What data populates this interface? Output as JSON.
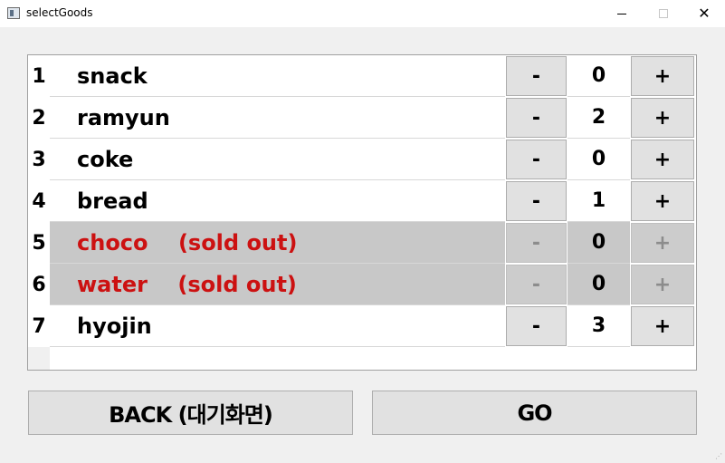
{
  "window": {
    "title": "selectGoods"
  },
  "items": [
    {
      "num": "1",
      "name": "snack",
      "qty": "0",
      "soldout": false
    },
    {
      "num": "2",
      "name": "ramyun",
      "qty": "2",
      "soldout": false
    },
    {
      "num": "3",
      "name": "coke",
      "qty": "0",
      "soldout": false
    },
    {
      "num": "4",
      "name": "bread",
      "qty": "1",
      "soldout": false
    },
    {
      "num": "5",
      "name": "choco    (sold out)",
      "qty": "0",
      "soldout": true
    },
    {
      "num": "6",
      "name": "water    (sold out)",
      "qty": "0",
      "soldout": true
    },
    {
      "num": "7",
      "name": "hyojin",
      "qty": "3",
      "soldout": false
    }
  ],
  "labels": {
    "minus": "-",
    "plus": "+"
  },
  "buttons": {
    "back": "BACK (대기화면)",
    "go": "GO"
  },
  "colors": {
    "soldout_text": "#cc1111",
    "soldout_bg": "#c8c8c8"
  }
}
